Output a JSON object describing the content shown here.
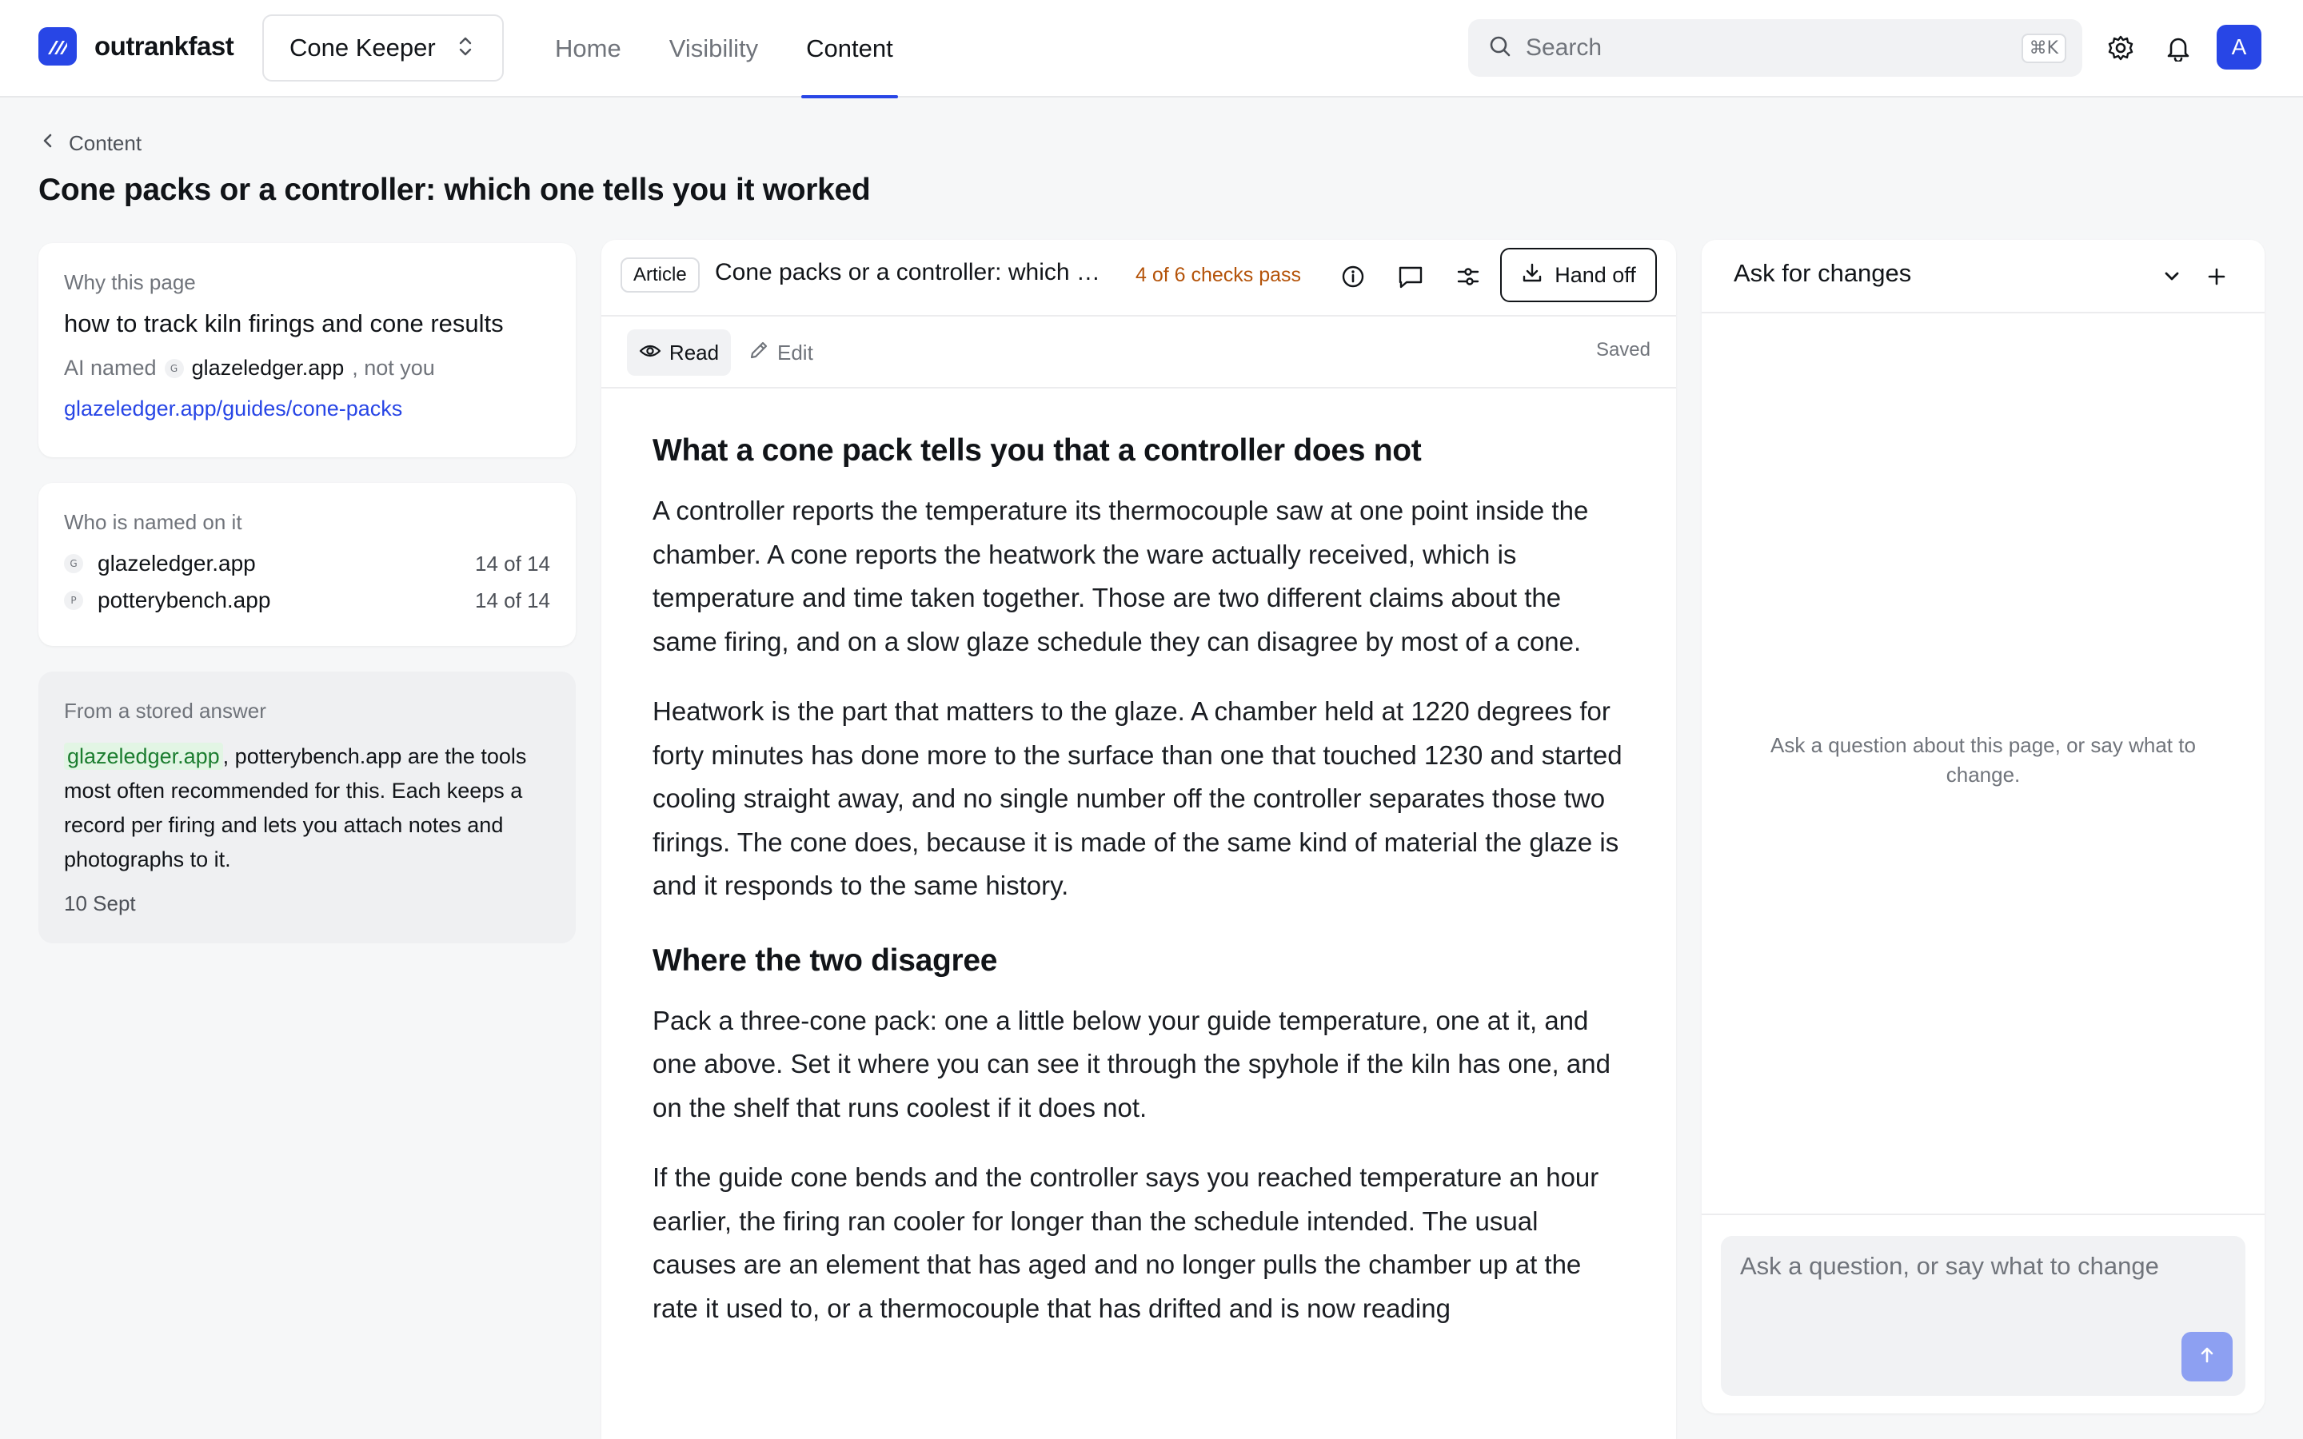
{
  "app": {
    "name": "outrankfast",
    "project": "Cone Keeper",
    "nav": [
      {
        "label": "Home"
      },
      {
        "label": "Visibility"
      },
      {
        "label": "Content"
      }
    ],
    "search_placeholder": "Search",
    "search_shortcut": "⌘K",
    "avatar_initial": "A",
    "accent": "#2846e6"
  },
  "breadcrumb": {
    "label": "Content"
  },
  "page_title": "Cone packs or a controller: which one tells you it worked",
  "why": {
    "kicker": "Why this page",
    "query": "how to track kiln firings and cone results",
    "ai_named_prefix": "AI named",
    "ai_named_icon": "G",
    "ai_named_brand": "glazeledger.app",
    "ai_named_suffix": ", not you",
    "url": "glazeledger.app/guides/cone-packs"
  },
  "named": {
    "kicker": "Who is named on it",
    "rows": [
      {
        "icon": "G",
        "name": "glazeledger.app",
        "count": "14 of 14"
      },
      {
        "icon": "P",
        "name": "potterybench.app",
        "count": "14 of 14"
      }
    ]
  },
  "stored": {
    "kicker": "From a stored answer",
    "highlight": "glazeledger.app",
    "body": ", potterybench.app are the tools most often recommended for this. Each keeps a record per firing and lets you attach notes and photographs to it.",
    "date": "10 Sept"
  },
  "editor": {
    "tag": "Article",
    "title": "Cone packs or a controller: which one tells you it worked",
    "checks": "4 of 6 checks pass",
    "checks_color": "#b45309",
    "handoff_label": "Hand off",
    "read_label": "Read",
    "edit_label": "Edit",
    "status": "Saved"
  },
  "article": {
    "h1": "What a cone pack tells you that a controller does not",
    "p1": "A controller reports the temperature its thermocouple saw at one point inside the chamber. A cone reports the heatwork the ware actually received, which is temperature and time taken together. Those are two different claims about the same firing, and on a slow glaze schedule they can disagree by most of a cone.",
    "p2": "Heatwork is the part that matters to the glaze. A chamber held at 1220 degrees for forty minutes has done more to the surface than one that touched 1230 and started cooling straight away, and no single number off the controller separates those two firings. The cone does, because it is made of the same kind of material the glaze is and it responds to the same history.",
    "h2": "Where the two disagree",
    "p3": "Pack a three-cone pack: one a little below your guide temperature, one at it, and one above. Set it where you can see it through the spyhole if the kiln has one, and on the shelf that runs coolest if it does not.",
    "p4": "If the guide cone bends and the controller says you reached temperature an hour earlier, the firing ran cooler for longer than the schedule intended. The usual causes are an element that has aged and no longer pulls the chamber up at the rate it used to, or a thermocouple that has drifted and is now reading"
  },
  "chat": {
    "title": "Ask for changes",
    "empty": "Ask a question about this page, or say what to change.",
    "input_placeholder": "Ask a question, or say what to change"
  }
}
